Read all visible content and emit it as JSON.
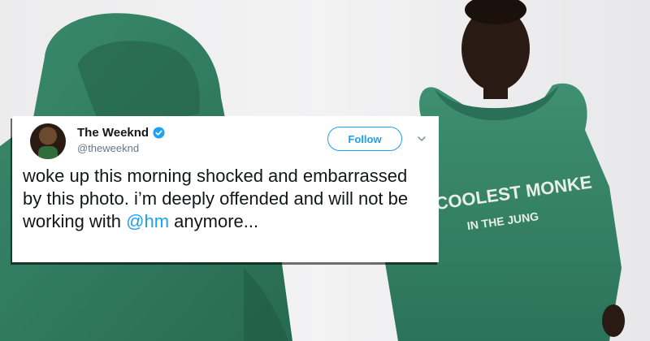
{
  "tweet": {
    "author_name": "The Weeknd",
    "author_handle": "@theweeknd",
    "follow_label": "Follow",
    "text_before": "woke up this morning shocked and embarrassed by this photo. i’m deeply offended and will not be working with ",
    "mention": "@hm",
    "text_after": " anymore...",
    "colors": {
      "accent": "#1da1f2",
      "text": "#14171a",
      "muted": "#657786"
    }
  },
  "photo": {
    "shirt_print_line1": "COOLEST MONKE",
    "shirt_print_line2": "IN THE JUNG",
    "hoodie_color": "#2f7a5f"
  }
}
